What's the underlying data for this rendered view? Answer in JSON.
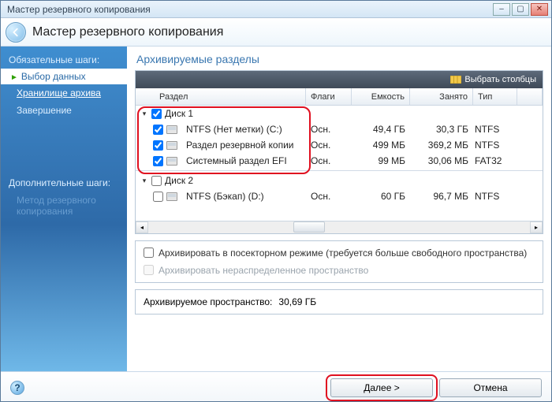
{
  "window": {
    "title": "Мастер резервного копирования"
  },
  "header": {
    "title": "Мастер резервного копирования"
  },
  "sidebar": {
    "required_label": "Обязательные шаги:",
    "items": [
      {
        "label": "Выбор данных",
        "kind": "current"
      },
      {
        "label": "Хранилище архива",
        "kind": "link"
      },
      {
        "label": "Завершение",
        "kind": "plain"
      }
    ],
    "optional_label": "Дополнительные шаги:",
    "optional_items": [
      {
        "label": "Метод резервного копирования"
      }
    ]
  },
  "main": {
    "heading": "Архивируемые разделы",
    "choose_columns": "Выбрать столбцы",
    "columns": {
      "partition": "Раздел",
      "flags": "Флаги",
      "capacity": "Емкость",
      "used": "Занято",
      "type": "Тип"
    },
    "disks": [
      {
        "name": "Диск 1",
        "checked": true,
        "rows": [
          {
            "checked": true,
            "name": "NTFS (Нет метки) (C:)",
            "flags": "Осн.",
            "capacity": "49,4 ГБ",
            "used": "30,3 ГБ",
            "type": "NTFS"
          },
          {
            "checked": true,
            "name": "Раздел резервной копии",
            "flags": "Осн.",
            "capacity": "499 МБ",
            "used": "369,2 МБ",
            "type": "NTFS"
          },
          {
            "checked": true,
            "name": "Системный раздел EFI",
            "flags": "Осн.",
            "capacity": "99 МБ",
            "used": "30,06 МБ",
            "type": "FAT32"
          }
        ]
      },
      {
        "name": "Диск 2",
        "checked": false,
        "rows": [
          {
            "checked": false,
            "name": "NTFS (Бэкап) (D:)",
            "flags": "Осн.",
            "capacity": "60 ГБ",
            "used": "96,7 МБ",
            "type": "NTFS"
          }
        ]
      }
    ],
    "options": {
      "sector": {
        "checked": false,
        "label": "Архивировать в посекторном режиме (требуется больше свободного пространства)"
      },
      "unalloc": {
        "checked": false,
        "disabled": true,
        "label": "Архивировать нераспределенное пространство"
      }
    },
    "summary": {
      "label": "Архивируемое пространство:",
      "value": "30,69 ГБ"
    }
  },
  "footer": {
    "next": "Далее >",
    "cancel": "Отмена"
  }
}
